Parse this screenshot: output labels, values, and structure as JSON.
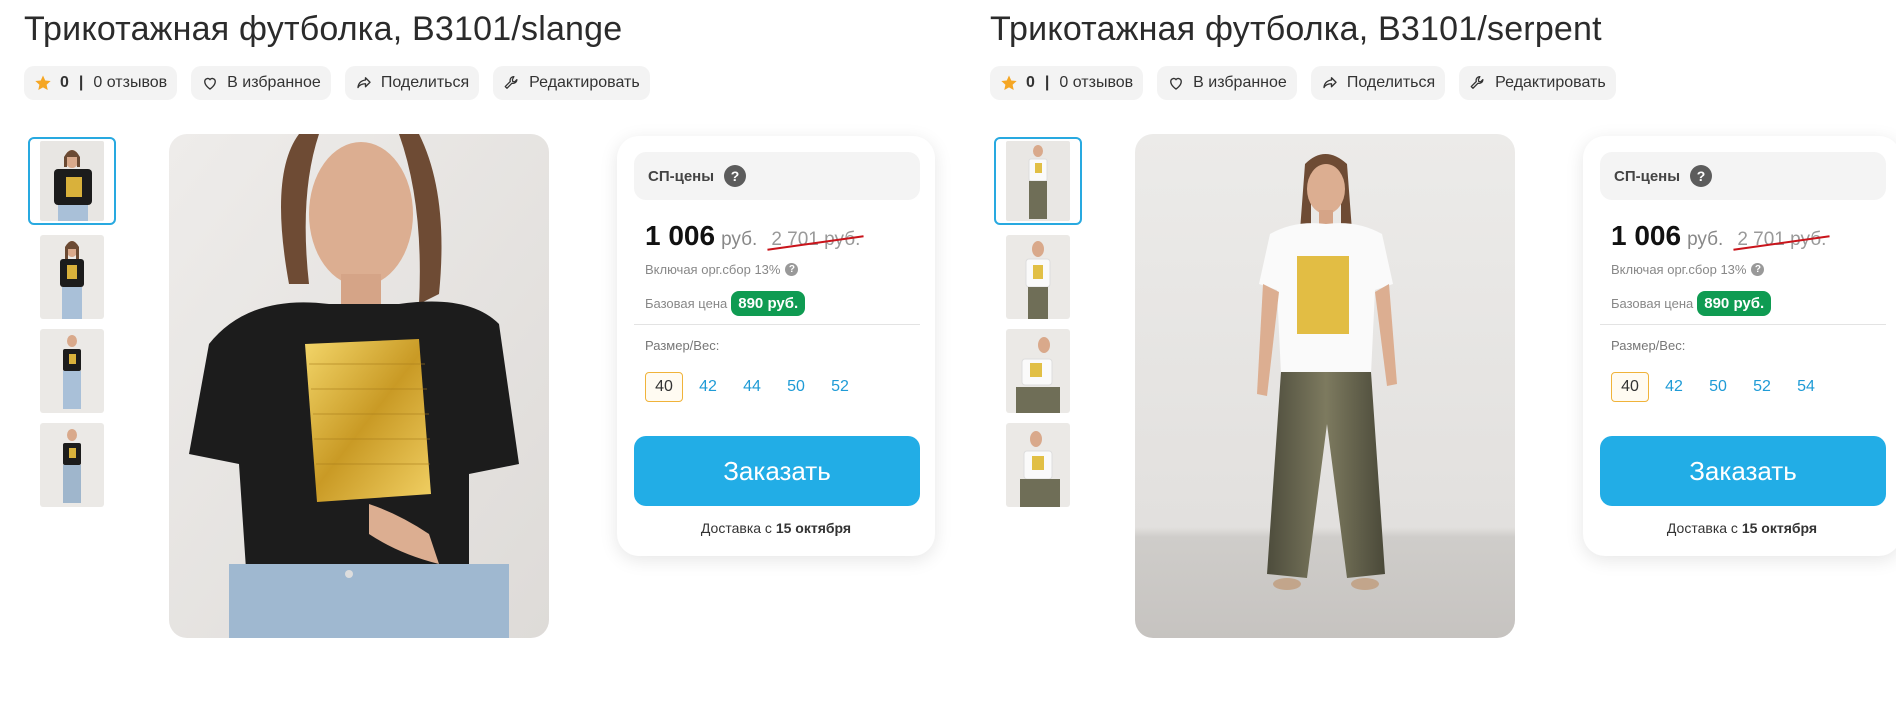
{
  "products": [
    {
      "title": "Трикотажная футболка, B3101/slange",
      "actions": {
        "rating": "0",
        "separator": "|",
        "reviews": "0 отзывов",
        "favorite": "В избранное",
        "share": "Поделиться",
        "edit": "Редактировать"
      },
      "sp_label": "СП-цены",
      "help": "?",
      "price": "1 006",
      "currency": "руб.",
      "old_price": "2 701 руб.",
      "fee_note": "Включая орг.сбор 13%",
      "base_label": "Базовая цена",
      "base_price": "890 руб.",
      "size_label": "Размер/Вес:",
      "sizes": [
        "40",
        "42",
        "44",
        "50",
        "52"
      ],
      "selected_size": "40",
      "order_label": "Заказать",
      "delivery_prefix": "Доставка с",
      "delivery_date": "15 октября",
      "shirt_color": "#1c1c1c"
    },
    {
      "title": "Трикотажная футболка, B3101/serpent",
      "actions": {
        "rating": "0",
        "separator": "|",
        "reviews": "0 отзывов",
        "favorite": "В избранное",
        "share": "Поделиться",
        "edit": "Редактировать"
      },
      "sp_label": "СП-цены",
      "help": "?",
      "price": "1 006",
      "currency": "руб.",
      "old_price": "2 701 руб.",
      "fee_note": "Включая орг.сбор 13%",
      "base_label": "Базовая цена",
      "base_price": "890 руб.",
      "size_label": "Размер/Вес:",
      "sizes": [
        "40",
        "42",
        "50",
        "52",
        "54"
      ],
      "selected_size": "40",
      "order_label": "Заказать",
      "delivery_prefix": "Доставка с",
      "delivery_date": "15 октября",
      "shirt_color": "#fafafa"
    }
  ],
  "colors": {
    "accent_blue": "#22ade6",
    "badge_green": "#0f9b52",
    "strike_red": "#c9141b",
    "star": "#f5a623",
    "selected_size_border": "#f0b33a"
  },
  "icons": [
    "star-icon",
    "heart-icon",
    "share-icon",
    "wrench-icon",
    "question-icon"
  ]
}
